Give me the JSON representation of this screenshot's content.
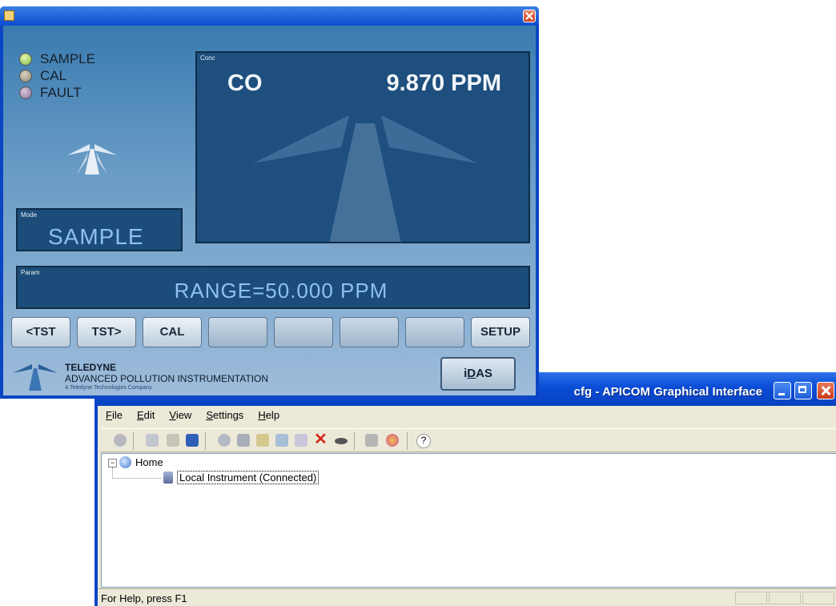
{
  "apicom": {
    "title": "cfg - APICOM Graphical Interface",
    "menu": [
      "File",
      "Edit",
      "View",
      "Settings",
      "Help"
    ],
    "tree": {
      "root": "Home",
      "child": "Local Instrument (Connected)"
    },
    "status": "For Help, press F1"
  },
  "instrument": {
    "indicators": {
      "sample": "SAMPLE",
      "cal": "CAL",
      "fault": "FAULT"
    },
    "mode": {
      "label": "Mode",
      "value": "SAMPLE"
    },
    "conc": {
      "label": "Conc",
      "gas": "CO",
      "reading": "9.870 PPM"
    },
    "param": {
      "label": "Param",
      "value": "RANGE=50.000 PPM"
    },
    "keys": [
      "<TST",
      "TST>",
      "CAL",
      "",
      "",
      "",
      "",
      "SETUP"
    ],
    "brand": {
      "name": "TELEDYNE",
      "division": "ADVANCED POLLUTION INSTRUMENTATION",
      "tagline": "A Teledyne Technologies Company"
    },
    "idas": {
      "prefix": "i",
      "underlined": "D",
      "suffix": "AS"
    }
  },
  "colors": {
    "xp_title_blue": "#0a4cd6",
    "panel_blue": "#1e4f7e",
    "readout_text": "#8fc0ef"
  }
}
